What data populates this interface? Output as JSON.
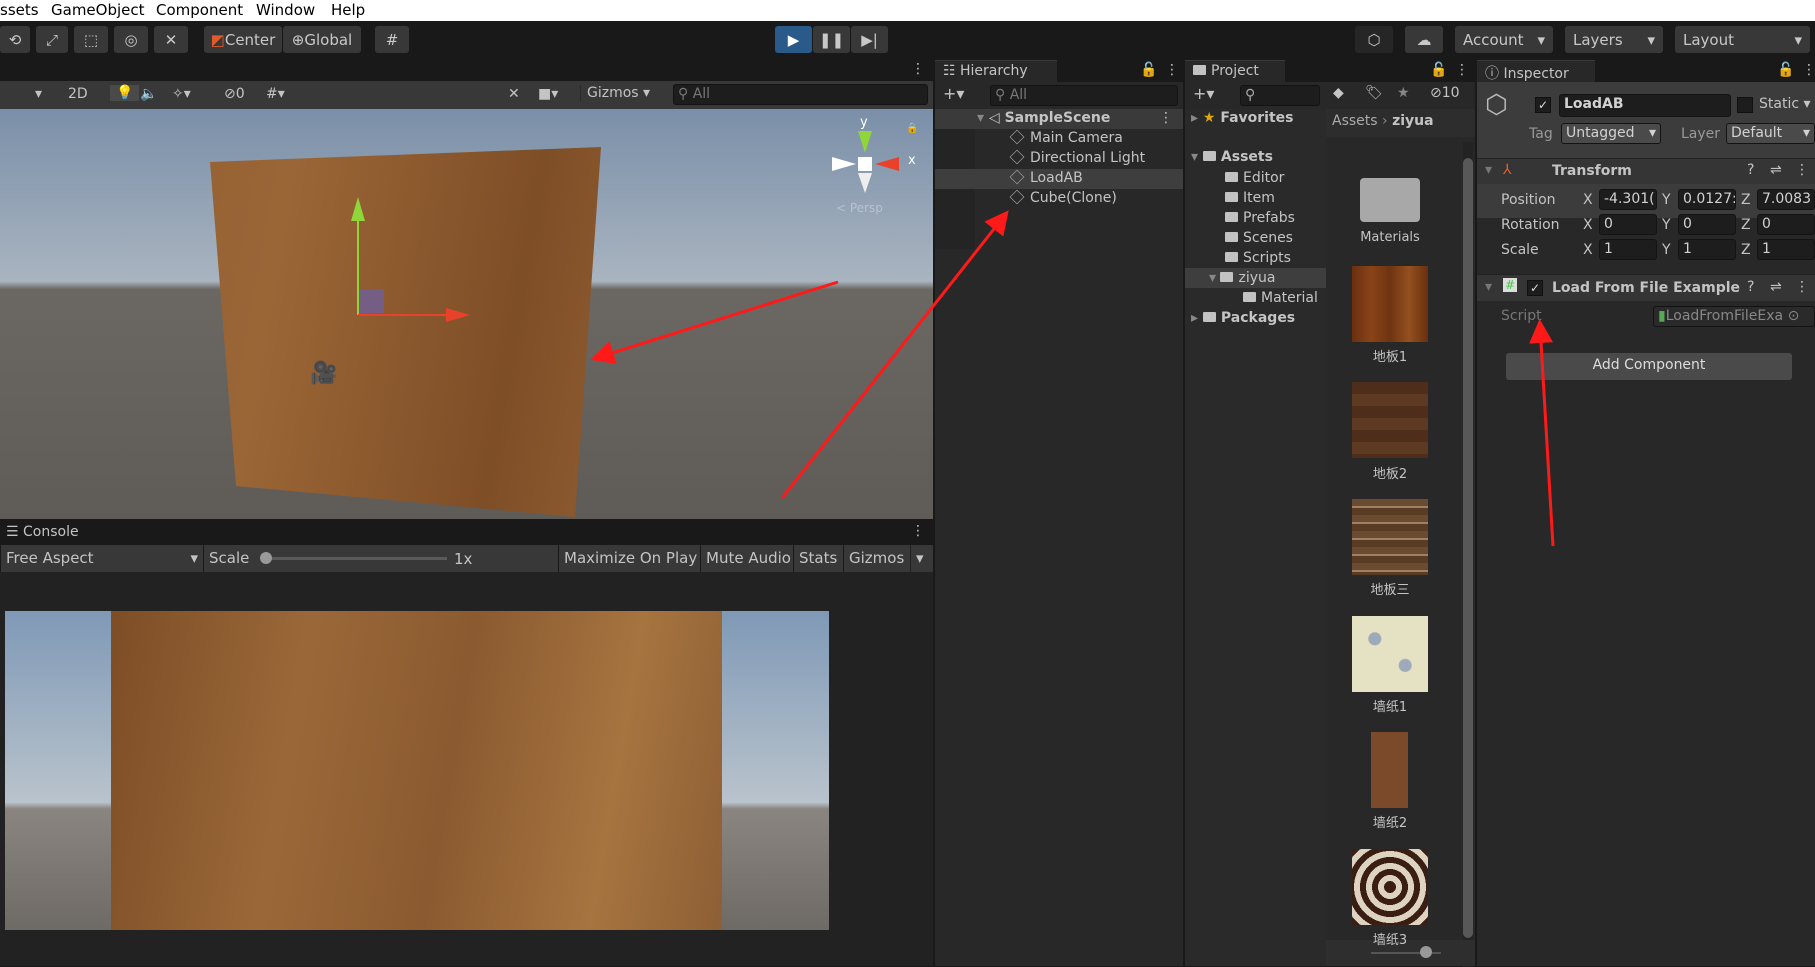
{
  "menu": [
    "ssets",
    "GameObject",
    "Component",
    "Window",
    "Help"
  ],
  "toolbar": {
    "center": "Center",
    "global": "Global",
    "account": "Account",
    "layers": "Layers",
    "layout": "Layout",
    "play_color": "#2a5a8a"
  },
  "scene": {
    "mode_2d": "2D",
    "hidden_count": "0",
    "gizmos": "Gizmos",
    "search_placeholder": "All",
    "axis_y": "y",
    "axis_x": "x",
    "persp": "< Persp"
  },
  "console": {
    "tab": "Console"
  },
  "game": {
    "aspect": "Free Aspect",
    "scale_label": "Scale",
    "scale_value": "1x",
    "scale_level": 0,
    "maximize": "Maximize On Play",
    "mute": "Mute Audio",
    "stats": "Stats",
    "gizmos": "Gizmos"
  },
  "hierarchy": {
    "tab": "Hierarchy",
    "search_placeholder": "All",
    "scene": "SampleScene",
    "items": [
      "Main Camera",
      "Directional Light",
      "LoadAB",
      "Cube(Clone)"
    ],
    "selected": "LoadAB"
  },
  "project": {
    "tab": "Project",
    "hidden_count": "10",
    "favorites": "Favorites",
    "assets": "Assets",
    "folders": [
      "Editor",
      "Item",
      "Prefabs",
      "Scenes",
      "Scripts"
    ],
    "ziyua": "ziyua",
    "material": "Material",
    "packages": "Packages",
    "breadcrumb": [
      "Assets",
      "ziyua"
    ],
    "grid": [
      "Materials",
      "地板1",
      "地板2",
      "地板三",
      "墙纸1",
      "墙纸2",
      "墙纸3"
    ]
  },
  "inspector": {
    "tab": "Inspector",
    "name": "LoadAB",
    "static": "Static",
    "tag_label": "Tag",
    "tag": "Untagged",
    "layer_label": "Layer",
    "layer": "Default",
    "transform": "Transform",
    "position": "Position",
    "rotation": "Rotation",
    "scale": "Scale",
    "pos": [
      "-4.301(",
      "0.0127:",
      "7.0083"
    ],
    "rot": [
      "0",
      "0",
      "0"
    ],
    "scl": [
      "1",
      "1",
      "1"
    ],
    "axes": [
      "X",
      "Y",
      "Z"
    ],
    "component": "Load From File Example (:",
    "script_label": "Script",
    "script_value": "LoadFromFileExa",
    "add_component": "Add Component"
  },
  "annotation_color": "#ff1a1a"
}
